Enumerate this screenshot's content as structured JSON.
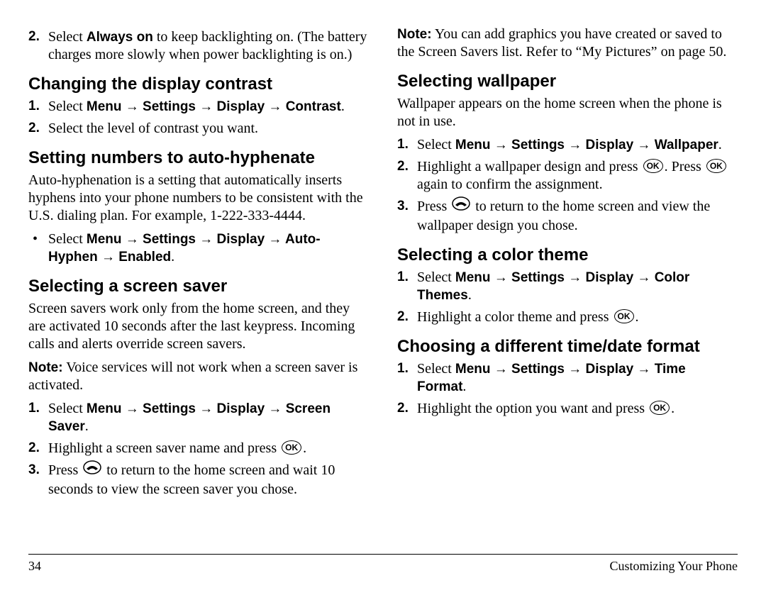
{
  "footer": {
    "page": "34",
    "section": "Customizing Your Phone"
  },
  "icons": {
    "ok": "OK"
  },
  "top": {
    "num": "2.",
    "pre": "Select ",
    "bold": "Always on",
    "post": " to keep backlighting on. (The battery charges more slowly when power backlighting is on.)"
  },
  "contrast": {
    "heading": "Changing the display contrast",
    "s1num": "1.",
    "s1pre": "Select ",
    "s1path": "Menu → Settings → Display → Contrast",
    "s1post": ".",
    "s2num": "2.",
    "s2": "Select the level of contrast you want."
  },
  "hyphen": {
    "heading": "Setting numbers to auto-hyphenate",
    "intro": "Auto-hyphenation is a setting that automatically inserts hyphens into your phone numbers to be consistent with the U.S. dialing plan. For example, 1-222-333-4444.",
    "b1pre": "Select ",
    "b1path": "Menu → Settings → Display → Auto-Hyphen → Enabled",
    "b1post": "."
  },
  "saver": {
    "heading": "Selecting a screen saver",
    "intro": "Screen savers work only from the home screen, and they are activated 10 seconds after the last keypress. Incoming calls and alerts override screen savers.",
    "noteLabel": "Note:",
    "note": "  Voice services will not work when a screen saver is activated.",
    "s1num": "1.",
    "s1pre": "Select ",
    "s1path": "Menu → Settings → Display → Screen Saver",
    "s1post": ".",
    "s2num": "2.",
    "s2pre": "Highlight a screen saver name and press ",
    "s2post": ".",
    "s3num": "3.",
    "s3pre": "Press ",
    "s3post": " to return to the home screen and wait 10 seconds to view the screen saver you chose.",
    "note2Label": "Note:",
    "note2": "  You can add graphics you have created or saved to the Screen Savers list. Refer to “My Pictures” on page 50."
  },
  "wallpaper": {
    "heading": "Selecting wallpaper",
    "intro": "Wallpaper appears on the home screen when the phone is not in use.",
    "s1num": "1.",
    "s1pre": "Select ",
    "s1path": "Menu → Settings → Display → Wallpaper",
    "s1post": ".",
    "s2num": "2.",
    "s2pre": "Highlight a wallpaper design and press ",
    "s2mid": ". Press ",
    "s2post": " again to confirm the assignment.",
    "s3num": "3.",
    "s3pre": "Press ",
    "s3post": " to return to the home screen and view the wallpaper design you chose."
  },
  "theme": {
    "heading": "Selecting a color theme",
    "s1num": "1.",
    "s1pre": "Select ",
    "s1path": "Menu → Settings → Display → Color Themes",
    "s1post": ".",
    "s2num": "2.",
    "s2pre": "Highlight a color theme and press ",
    "s2post": "."
  },
  "timeformat": {
    "heading": "Choosing a different time/date format",
    "s1num": "1.",
    "s1pre": "Select ",
    "s1path": "Menu → Settings → Display → Time Format",
    "s1post": ".",
    "s2num": "2.",
    "s2pre": "Highlight the option you want and press ",
    "s2post": "."
  }
}
